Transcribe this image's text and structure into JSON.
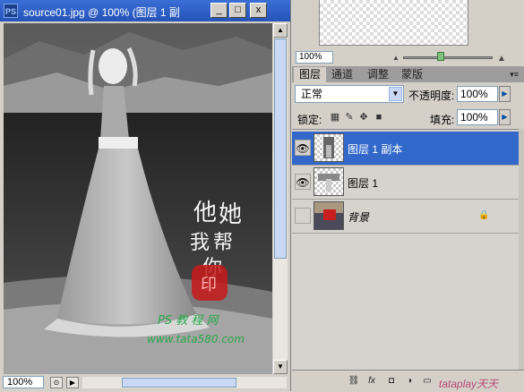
{
  "document": {
    "app_icon": "PS",
    "title": "source01.jpg @ 100% (图层 1 副",
    "buttons": {
      "minimize": "_",
      "restore": "□",
      "close": "x"
    },
    "zoom": "100%",
    "image": {
      "calligraphy_lines": [
        "他",
        "她",
        "我",
        "帮",
        "你"
      ],
      "seal_text": "印",
      "watermark_title": "PS 教 程 网",
      "watermark_url": "www.tata580.com"
    }
  },
  "navigator": {
    "zoom": "100%"
  },
  "layers_panel": {
    "tabs": [
      {
        "label": "图层",
        "active": true
      },
      {
        "label": "通道",
        "active": false
      },
      {
        "label": "调整",
        "active": false
      },
      {
        "label": "蒙版",
        "active": false
      }
    ],
    "blend_mode": "正常",
    "opacity_label": "不透明度:",
    "opacity": "100%",
    "lock_label": "锁定:",
    "fill_label": "填充:",
    "fill": "100%",
    "layers": [
      {
        "name": "图层 1 副本",
        "visible": true,
        "selected": true
      },
      {
        "name": "图层 1",
        "visible": true,
        "selected": false
      },
      {
        "name": "背景",
        "visible": false,
        "selected": false,
        "locked": true
      }
    ],
    "footer_watermark": "tataplay天天"
  },
  "colors": {
    "selection": "#3168c9",
    "titlebar": "#2553b8"
  }
}
